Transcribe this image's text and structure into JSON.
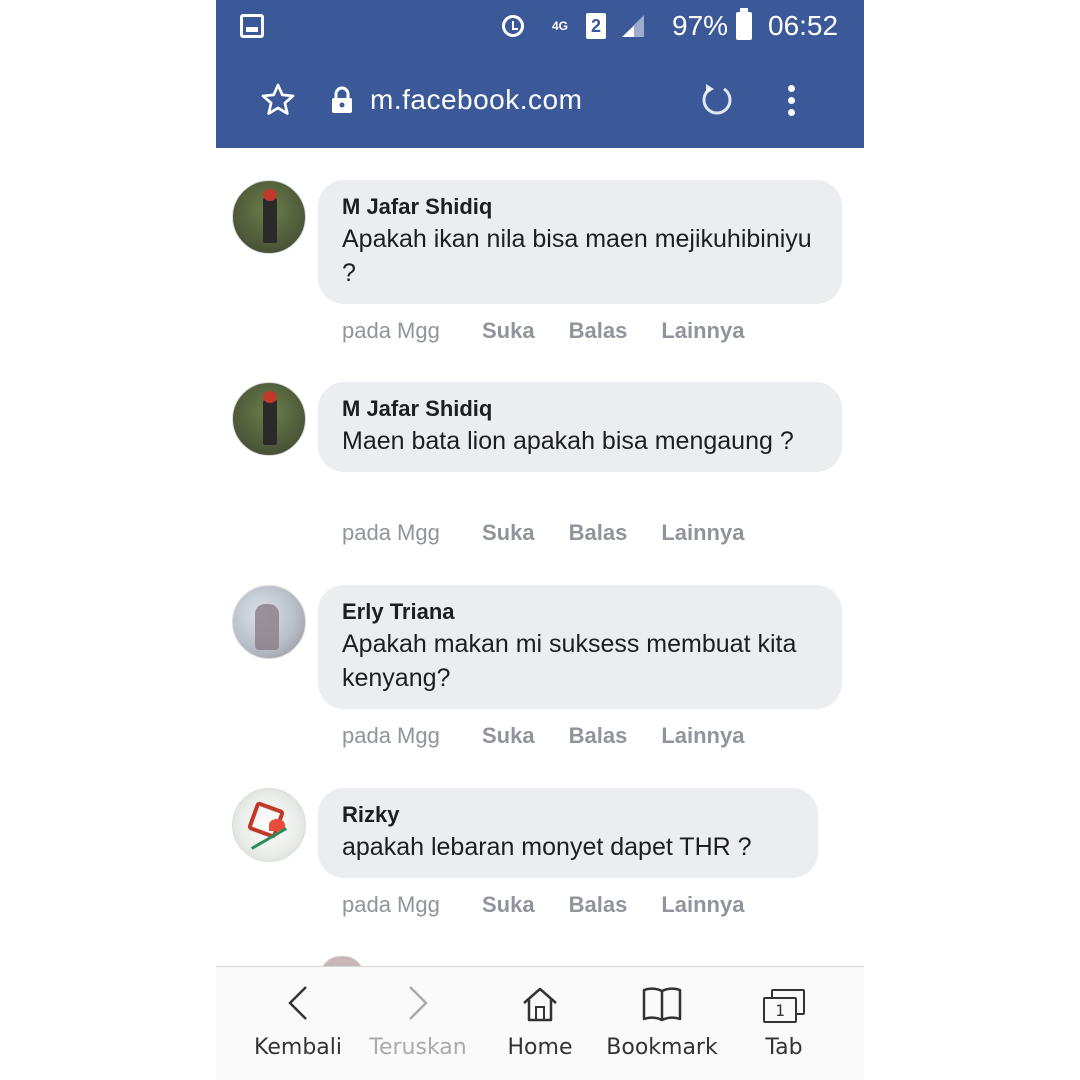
{
  "status_bar": {
    "network": "4G",
    "sim_slot": "2",
    "battery": "97%",
    "time": "06:52",
    "icons": [
      "gallery-icon",
      "alarm-icon",
      "signal-icon",
      "battery-icon"
    ]
  },
  "url_bar": {
    "url": "m.facebook.com",
    "icons": [
      "star-icon",
      "lock-icon",
      "reload-icon",
      "more-menu-icon"
    ]
  },
  "comments": [
    {
      "author": "M Jafar Shidiq",
      "text": "Apakah ikan nila bisa maen mejikuhibiniyu ?",
      "time": "pada Mgg",
      "like": "Suka",
      "reply": "Balas",
      "more": "Lainnya"
    },
    {
      "author": "M Jafar Shidiq",
      "text": "Maen bata lion apakah bisa mengaung ?",
      "time": "pada Mgg",
      "like": "Suka",
      "reply": "Balas",
      "more": "Lainnya"
    },
    {
      "author": "Erly Triana",
      "text": "Apakah makan mi suksess membuat kita kenyang?",
      "time": "pada Mgg",
      "like": "Suka",
      "reply": "Balas",
      "more": "Lainnya"
    },
    {
      "author": "Rizky",
      "text": "apakah lebaran monyet dapet THR ?",
      "time": "pada Mgg",
      "like": "Suka",
      "reply": "Balas",
      "more": "Lainnya"
    }
  ],
  "bottom_nav": {
    "back": "Kembali",
    "forward": "Teruskan",
    "home": "Home",
    "bookmark": "Bookmark",
    "tabs": "Tab",
    "tab_count": "1"
  },
  "colors": {
    "brand_blue": "#3b5998",
    "bubble_bg": "#ebedf0",
    "meta_gray": "#90949c"
  }
}
